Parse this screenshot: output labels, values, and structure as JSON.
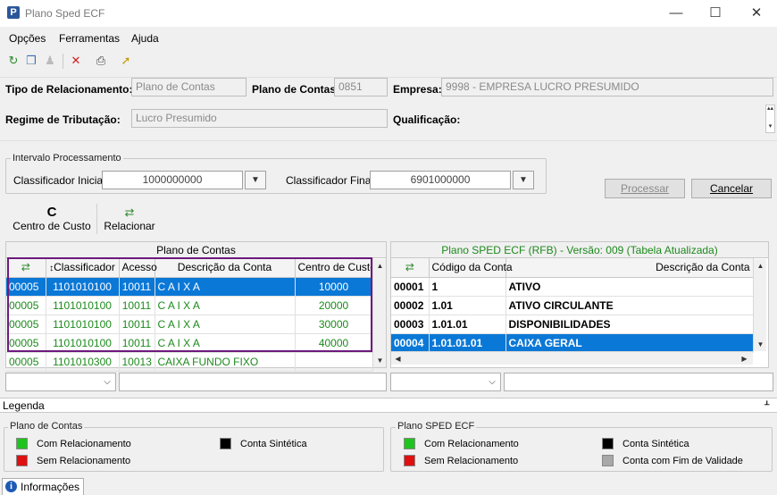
{
  "window": {
    "title": "Plano Sped ECF",
    "min": "—",
    "max": "☐",
    "close": "✕"
  },
  "menu": [
    "Opções",
    "Ferramentas",
    "Ajuda"
  ],
  "toolbar": [
    {
      "icon": "refresh-icon",
      "glyph": "↻",
      "color": "#2b8a2b"
    },
    {
      "icon": "copy-icon",
      "glyph": "❐",
      "color": "#3a6fb0"
    },
    {
      "icon": "user-icon",
      "glyph": "♟",
      "color": "#bbbbbb"
    },
    {
      "icon": "delete-icon",
      "glyph": "✕",
      "color": "#d42020"
    },
    {
      "icon": "print-icon",
      "glyph": "⎙",
      "color": "#444444"
    },
    {
      "icon": "export-icon",
      "glyph": "➚",
      "color": "#c79600"
    }
  ],
  "header": {
    "tipo_label": "Tipo de Relacionamento:",
    "tipo_value": "Plano de Contas",
    "plano_label": "Plano de Contas:",
    "plano_value": "0851",
    "empresa_label": "Empresa:",
    "empresa_value": "9998 - EMPRESA LUCRO PRESUMIDO",
    "regime_label": "Regime de Tributação:",
    "regime_value": "Lucro Presumido",
    "qualif_label": "Qualificação:"
  },
  "intervalo": {
    "title": "Intervalo Processamento",
    "inicial_label": "Classificador Inicial:",
    "inicial_value": "1000000000",
    "final_label": "Classificador Final:",
    "final_value": "6901000000"
  },
  "buttons": {
    "processar": "Processar",
    "cancelar": "Cancelar",
    "centro_icon": "C",
    "centro": "Centro de Custo",
    "relacionar": "Relacionar"
  },
  "left": {
    "title": "Plano de Contas",
    "cols": [
      "Classificador",
      "Acesso",
      "Descrição da Conta",
      "Centro de Custo"
    ],
    "rows": [
      {
        "id": "00005",
        "cls": "1101010100",
        "acc": "10011",
        "desc": "C A I X A",
        "cc": "10000",
        "sel": true
      },
      {
        "id": "00005",
        "cls": "1101010100",
        "acc": "10011",
        "desc": "C A I X A",
        "cc": "20000",
        "sel": false
      },
      {
        "id": "00005",
        "cls": "1101010100",
        "acc": "10011",
        "desc": "C A I X A",
        "cc": "30000",
        "sel": false
      },
      {
        "id": "00005",
        "cls": "1101010100",
        "acc": "10011",
        "desc": "C A I X A",
        "cc": "40000",
        "sel": false
      },
      {
        "id": "00005",
        "cls": "1101010300",
        "acc": "10013",
        "desc": "CAIXA FUNDO FIXO",
        "cc": "",
        "sel": false
      }
    ]
  },
  "right": {
    "title": "Plano SPED ECF (RFB) - Versão: 009 (Tabela Atualizada)",
    "cols": [
      "Código da Conta",
      "Descrição da Conta"
    ],
    "rows": [
      {
        "id": "00001",
        "cod": "1",
        "desc": "ATIVO",
        "sel": false
      },
      {
        "id": "00002",
        "cod": "1.01",
        "desc": "ATIVO CIRCULANTE",
        "sel": false
      },
      {
        "id": "00003",
        "cod": "1.01.01",
        "desc": "DISPONIBILIDADES",
        "sel": false
      },
      {
        "id": "00004",
        "cod": "1.01.01.01",
        "desc": "CAIXA GERAL",
        "sel": true
      }
    ]
  },
  "legenda": {
    "title": "Legenda",
    "pin": "ᚆ",
    "plano_title": "Plano de Contas",
    "sped_title": "Plano SPED ECF",
    "com": "Com Relacionamento",
    "sem": "Sem Relacionamento",
    "sint": "Conta Sintética",
    "fim": "Conta com Fim de Validade",
    "colors": {
      "com": "#1ec41e",
      "sem": "#e01010",
      "sint": "#000000",
      "fim": "#a8a8a8"
    }
  },
  "footer": {
    "tab": "Informações"
  }
}
